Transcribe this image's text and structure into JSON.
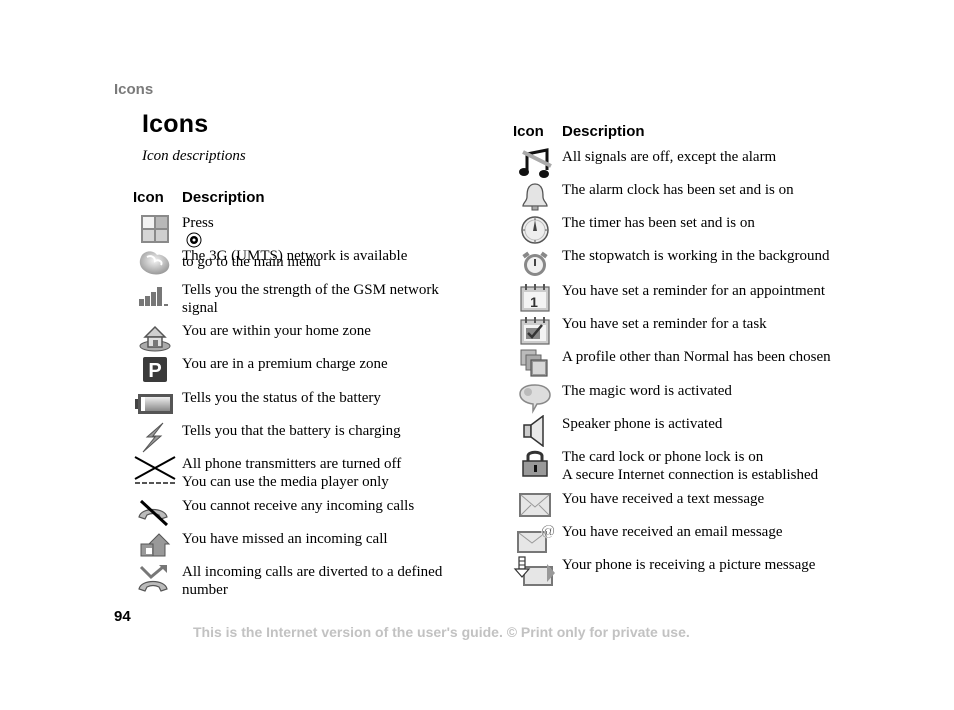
{
  "running_head": "Icons",
  "title": "Icons",
  "subtitle": "Icon descriptions",
  "table_headers": {
    "icon": "Icon",
    "description": "Description"
  },
  "left_column": [
    {
      "icon": "main-menu-icon",
      "text_before": "Press",
      "inline_icon": "navigation-key-icon",
      "text_after": "to go to the main menu"
    },
    {
      "icon": "3g-network-icon",
      "lines": [
        "The 3G (UMTS) network is available"
      ]
    },
    {
      "icon": "signal-strength-icon",
      "lines": [
        "Tells you the strength of the GSM network",
        "signal"
      ]
    },
    {
      "icon": "home-zone-icon",
      "lines": [
        "You are within your home zone"
      ]
    },
    {
      "icon": "premium-charge-icon",
      "lines": [
        "You are in a premium charge zone"
      ]
    },
    {
      "icon": "battery-icon",
      "lines": [
        "Tells you the status of the battery"
      ]
    },
    {
      "icon": "charging-icon",
      "lines": [
        "Tells you that the battery is charging"
      ]
    },
    {
      "icon": "flight-mode-icon",
      "lines": [
        "All phone transmitters are turned off",
        "You can use the media player only"
      ]
    },
    {
      "icon": "no-incoming-calls-icon",
      "lines": [
        "You cannot receive any incoming calls"
      ]
    },
    {
      "icon": "missed-call-icon",
      "lines": [
        "You have missed an incoming call"
      ]
    },
    {
      "icon": "call-divert-icon",
      "lines": [
        "All incoming calls are diverted to a defined",
        "number"
      ]
    }
  ],
  "right_column": [
    {
      "icon": "silent-mode-icon",
      "lines": [
        "All signals are off, except the alarm"
      ]
    },
    {
      "icon": "alarm-bell-icon",
      "lines": [
        "The alarm clock has been set and is on"
      ]
    },
    {
      "icon": "timer-icon",
      "lines": [
        "The timer has been set and is on"
      ]
    },
    {
      "icon": "stopwatch-icon",
      "lines": [
        "The stopwatch is working in the background"
      ]
    },
    {
      "icon": "appointment-reminder-icon",
      "lines": [
        "You have set a reminder for an appointment"
      ]
    },
    {
      "icon": "task-reminder-icon",
      "lines": [
        "You have set a reminder for a task"
      ]
    },
    {
      "icon": "profile-icon",
      "lines": [
        "A profile other than Normal has been chosen"
      ]
    },
    {
      "icon": "magic-word-icon",
      "lines": [
        "The magic word is activated"
      ]
    },
    {
      "icon": "speaker-icon",
      "lines": [
        "Speaker phone is activated"
      ]
    },
    {
      "icon": "lock-icon",
      "lines": [
        "The card lock or phone lock is on",
        "A secure Internet connection is established"
      ]
    },
    {
      "icon": "text-message-icon",
      "lines": [
        "You have received a text message"
      ]
    },
    {
      "icon": "email-message-icon",
      "lines": [
        "You have received an email message"
      ]
    },
    {
      "icon": "receiving-picture-message-icon",
      "lines": [
        "Your phone is receiving a picture message"
      ]
    }
  ],
  "page_number": "94",
  "footer": "This is the Internet version of the user's guide. © Print only for private use."
}
